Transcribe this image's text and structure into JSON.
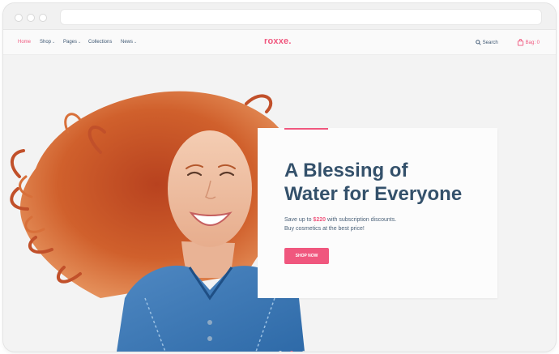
{
  "nav": {
    "items": [
      {
        "label": "Home",
        "active": true,
        "dropdown": false
      },
      {
        "label": "Shop",
        "active": false,
        "dropdown": true
      },
      {
        "label": "Pages",
        "active": false,
        "dropdown": true
      },
      {
        "label": "Collections",
        "active": false,
        "dropdown": false
      },
      {
        "label": "News",
        "active": false,
        "dropdown": true
      }
    ],
    "logo": "roxxe.",
    "search_label": "Search",
    "bag_label": "Bag: 0"
  },
  "hero": {
    "headline_line1": "A Blessing of",
    "headline_line2": "Water for Everyone",
    "sub_before": "Save up to",
    "sub_price": "$220",
    "sub_after": "with subscription discounts.",
    "sub_line2": "Buy cosmetics at the best price!",
    "cta_label": "SHOP NOW",
    "slides": [
      false,
      true,
      false
    ]
  },
  "colors": {
    "accent": "#f0577e",
    "heading": "#34516b",
    "background": "#f3f3f3"
  }
}
